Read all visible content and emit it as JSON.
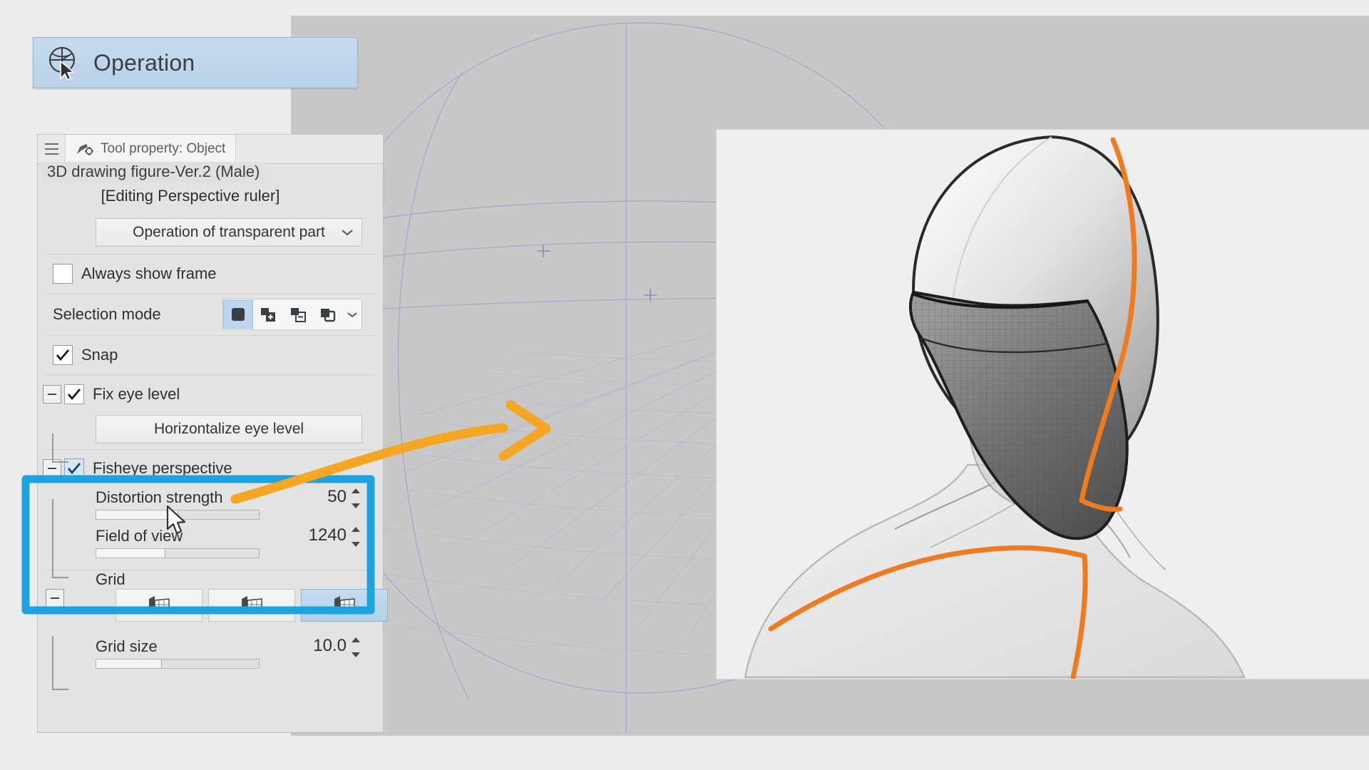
{
  "app": {
    "operation_header": {
      "label": "Operation",
      "icon": "3d-object-operation-icon"
    },
    "palette": {
      "menu_icon": "hamburger-menu-icon",
      "tab_icon": "tool-property-icon",
      "tab_label": "Tool property: Object",
      "object_name": "3D drawing figure-Ver.2 (Male)",
      "editing_state": "[Editing Perspective ruler]"
    },
    "properties": {
      "transparent_part_button": "Operation of transparent part",
      "always_show_frame": {
        "label": "Always show frame",
        "checked": false
      },
      "selection_mode": {
        "label": "Selection mode",
        "options": [
          {
            "name": "selection-mode-new",
            "selected": true
          },
          {
            "name": "selection-mode-add",
            "selected": false
          },
          {
            "name": "selection-mode-subtract",
            "selected": false
          },
          {
            "name": "selection-mode-intersect",
            "selected": false
          }
        ],
        "dropdown_icon": "chevron-down-icon"
      },
      "snap": {
        "label": "Snap",
        "checked": true
      },
      "fix_eye_level": {
        "label": "Fix eye level",
        "checked": true,
        "collapse_icon": "minus-box-icon",
        "horizontalize_button": "Horizontalize eye level"
      },
      "fisheye_perspective": {
        "label": "Fisheye perspective",
        "checked": true,
        "collapse_icon": "minus-box-icon",
        "distortion_strength": {
          "label": "Distortion strength",
          "value": "50",
          "fill_percent": 50
        },
        "field_of_view": {
          "label": "Field of view",
          "value": "1240",
          "fill_percent": 42
        }
      },
      "grid": {
        "label": "Grid",
        "collapse_icon": "minus-box-icon",
        "buttons": [
          {
            "name": "grid-type-floor-icon",
            "selected": false
          },
          {
            "name": "grid-type-wall-icon",
            "selected": false
          },
          {
            "name": "grid-type-both-icon",
            "selected": true
          }
        ],
        "grid_size": {
          "label": "Grid size",
          "value": "10.0",
          "fill_percent": 40
        }
      }
    },
    "annotations": {
      "highlight_color": "#1ca3e0",
      "arrow_color": "#f5a623",
      "highlight_target": "fisheye-perspective-section",
      "arrow_points_to": "canvas-viewport"
    },
    "canvas": {
      "model": "3d-male-figure-head-and-shoulders",
      "perspective_guide_color": "#9a96c8",
      "ruler_line_color": "#f07a1e",
      "background": "#efefef"
    }
  }
}
